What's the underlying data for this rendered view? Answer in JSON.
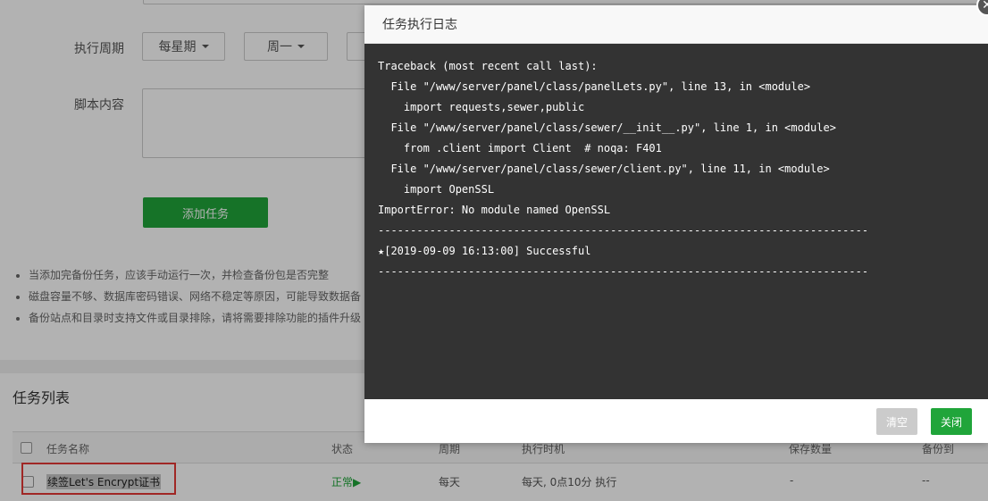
{
  "form": {
    "cycle_label": "执行周期",
    "cycle_type": "每星期",
    "cycle_day": "周一",
    "script_label": "脚本内容",
    "add_button": "添加任务"
  },
  "tips": [
    "当添加完备份任务，应该手动运行一次，并检查备份包是否完整",
    "磁盘容量不够、数据库密码错误、网络不稳定等原因，可能导致数据备",
    "备份站点和目录时支持文件或目录排除，请将需要排除功能的插件升级"
  ],
  "task_list": {
    "title": "任务列表",
    "columns": [
      "任务名称",
      "状态",
      "周期",
      "执行时机",
      "保存数量",
      "备份到"
    ],
    "rows": [
      {
        "name": "续签Let's Encrypt证书",
        "status": "正常",
        "status_icon": "play-triangle-icon",
        "period": "每天",
        "timing": "每天, 0点10分 执行",
        "save_count": "-",
        "backup_to": "--"
      }
    ]
  },
  "modal": {
    "title": "任务执行日志",
    "close_icon": "close-icon",
    "log_lines": [
      "Traceback (most recent call last):",
      "  File \"/www/server/panel/class/panelLets.py\", line 13, in <module>",
      "    import requests,sewer,public",
      "  File \"/www/server/panel/class/sewer/__init__.py\", line 1, in <module>",
      "    from .client import Client  # noqa: F401",
      "  File \"/www/server/panel/class/sewer/client.py\", line 11, in <module>",
      "    import OpenSSL",
      "ImportError: No module named OpenSSL",
      "----------------------------------------------------------------------------",
      "★[2019-09-09 16:13:00] Successful",
      "----------------------------------------------------------------------------"
    ],
    "clear_button": "清空",
    "close_button": "关闭"
  },
  "colors": {
    "accent": "#20a53a",
    "log_background": "#333333",
    "highlight": "#e53935"
  }
}
